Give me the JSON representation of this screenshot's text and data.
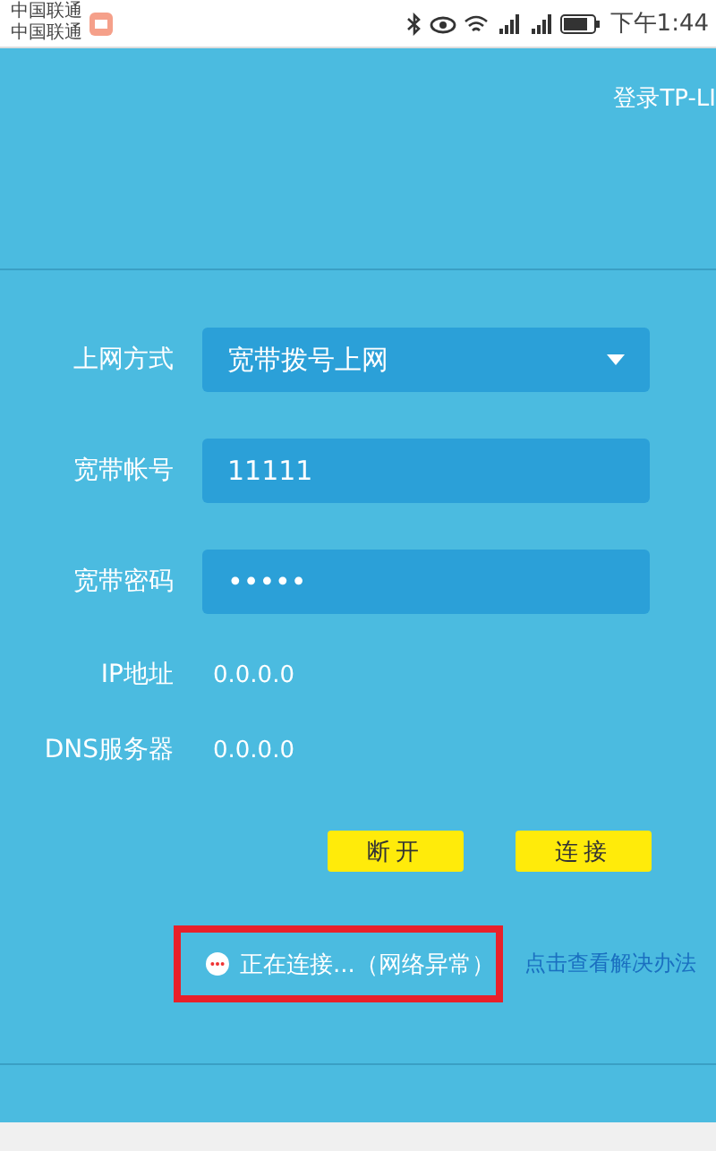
{
  "status_bar": {
    "carriers": [
      "中国联通",
      "中国联通"
    ],
    "time": "下午1:44"
  },
  "header": {
    "title": "登录TP-LI"
  },
  "form": {
    "rows": [
      {
        "kind": "select",
        "label": "上网方式",
        "value": "宽带拨号上网"
      },
      {
        "kind": "input",
        "label": "宽带帐号",
        "value": "11111"
      },
      {
        "kind": "input",
        "label": "宽带密码",
        "value": "•••••"
      },
      {
        "kind": "static",
        "label": "IP地址",
        "value": "0.0.0.0"
      },
      {
        "kind": "static",
        "label": "DNS服务器",
        "value": "0.0.0.0"
      }
    ]
  },
  "buttons": [
    "断开",
    "连接"
  ],
  "connection_status": {
    "text": "正在连接...（网络异常）",
    "highlighted": true,
    "link": "点击查看解决办法"
  }
}
